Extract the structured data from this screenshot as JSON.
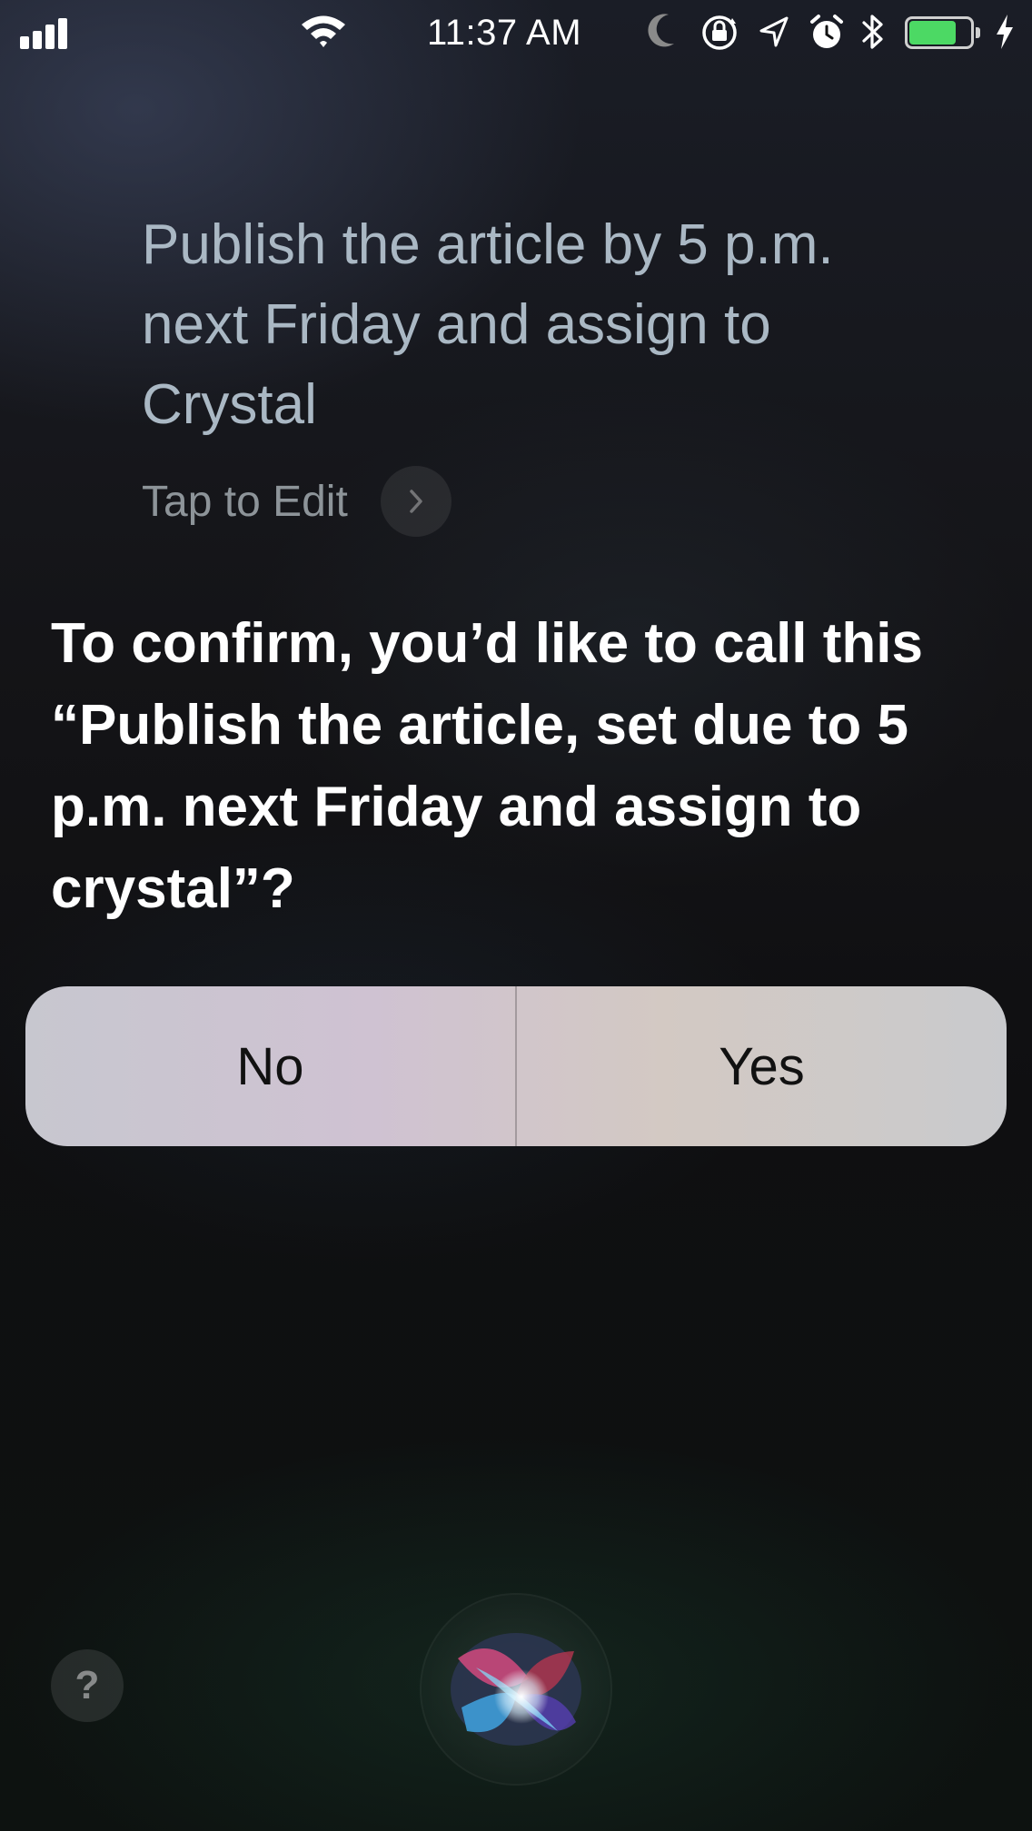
{
  "status_bar": {
    "time": "11:37 AM",
    "battery_level": 0.78,
    "battery_color": "#4cd964",
    "icons": [
      "cellular-signal-icon",
      "wifi-icon",
      "moon-icon",
      "rotation-lock-icon",
      "location-icon",
      "alarm-icon",
      "bluetooth-icon",
      "battery-icon",
      "charging-icon"
    ]
  },
  "query": {
    "text": "Publish the article by 5 p.m. next Friday and assign to Crystal",
    "edit_label": "Tap to Edit"
  },
  "response": {
    "text": "To confirm, you’d like to call this “Publish the article, set due to 5 p.m. next Friday and assign to crystal”?"
  },
  "buttons": {
    "no_label": "No",
    "yes_label": "Yes"
  },
  "bottom": {
    "help_label": "?"
  }
}
